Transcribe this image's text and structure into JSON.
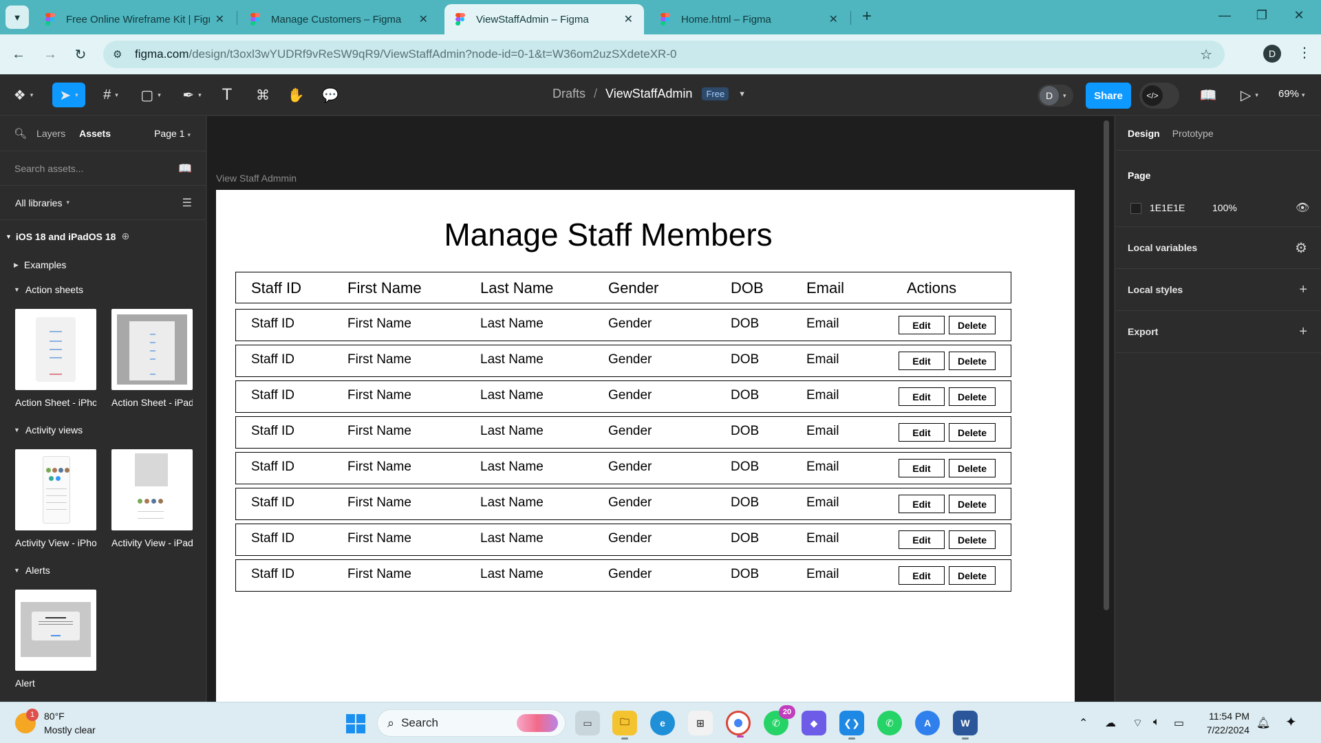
{
  "browser": {
    "tabs": [
      {
        "title": "Free Online Wireframe Kit | Figma",
        "active": false
      },
      {
        "title": "Manage Customers – Figma",
        "active": false
      },
      {
        "title": "ViewStaffAdmin – Figma",
        "active": true
      },
      {
        "title": "Home.html – Figma",
        "active": false
      }
    ],
    "url_host": "figma.com",
    "url_path": "/design/t3oxl3wYUDRf9vReSW9qR9/ViewStaffAdmin?node-id=0-1&t=W36om2uzSXdeteXR-0",
    "profile_initial": "D"
  },
  "figma": {
    "breadcrumb": {
      "folder": "Drafts",
      "file": "ViewStaffAdmin",
      "plan": "Free"
    },
    "user_initial": "D",
    "share_label": "Share",
    "zoom": "69%",
    "left_panel": {
      "tab_layers": "Layers",
      "tab_assets": "Assets",
      "page": "Page 1",
      "search_placeholder": "Search assets...",
      "libraries": "All libraries",
      "library_name": "iOS 18 and iPadOS 18",
      "sections": {
        "examples": "Examples",
        "action_sheets": "Action sheets",
        "activity_views": "Activity views",
        "alerts": "Alerts"
      },
      "assets": {
        "action_sheet_1": "Action Sheet - iPhone",
        "action_sheet_2": "Action Sheet - iPad",
        "activity_view_1": "Activity View - iPhone",
        "activity_view_2": "Activity View - iPad",
        "alert": "Alert"
      }
    },
    "right_panel": {
      "tab_design": "Design",
      "tab_prototype": "Prototype",
      "page_title": "Page",
      "page_color": "1E1E1E",
      "page_opacity": "100%",
      "local_variables": "Local variables",
      "local_styles": "Local styles",
      "export": "Export"
    },
    "canvas": {
      "frame_name": "View Staff Admmin",
      "page_title": "Manage Staff Members",
      "headers": [
        "Staff ID",
        "First Name",
        "Last Name",
        "Gender",
        "DOB",
        "Email",
        "Actions"
      ],
      "rows": [
        [
          "Staff ID",
          "First Name",
          "Last Name",
          "Gender",
          "DOB",
          "Email"
        ],
        [
          "Staff ID",
          "First Name",
          "Last Name",
          "Gender",
          "DOB",
          "Email"
        ],
        [
          "Staff ID",
          "First Name",
          "Last Name",
          "Gender",
          "DOB",
          "Email"
        ],
        [
          "Staff ID",
          "First Name",
          "Last Name",
          "Gender",
          "DOB",
          "Email"
        ],
        [
          "Staff ID",
          "First Name",
          "Last Name",
          "Gender",
          "DOB",
          "Email"
        ],
        [
          "Staff ID",
          "First Name",
          "Last Name",
          "Gender",
          "DOB",
          "Email"
        ],
        [
          "Staff ID",
          "First Name",
          "Last Name",
          "Gender",
          "DOB",
          "Email"
        ],
        [
          "Staff ID",
          "First Name",
          "Last Name",
          "Gender",
          "DOB",
          "Email"
        ]
      ],
      "edit_label": "Edit",
      "delete_label": "Delete"
    },
    "help": "?"
  },
  "taskbar": {
    "weather_temp": "80°F",
    "weather_desc": "Mostly clear",
    "weather_badge": "1",
    "search": "Search",
    "whatsapp_badge": "20",
    "time": "11:54 PM",
    "date": "7/22/2024"
  },
  "colors": {
    "accent": "#0d99ff",
    "chrome_tabstrip": "#4fb5bf",
    "canvas_bg": "#1e1e1e"
  }
}
